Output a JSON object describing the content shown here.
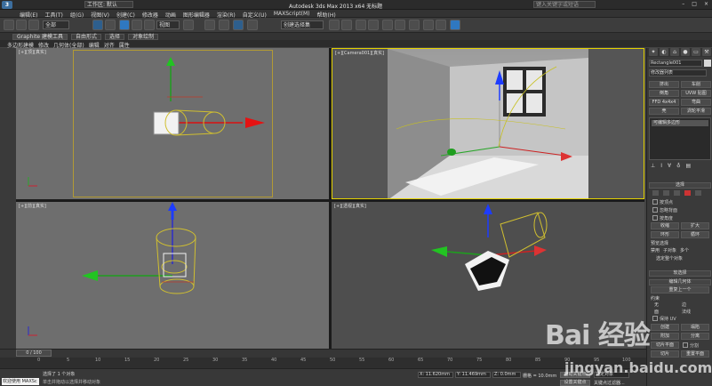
{
  "titlebar": {
    "logo": "3",
    "menu": [
      "编辑(E)",
      "工具(T)",
      "组(G)",
      "视图(V)"
    ],
    "workspace": "工作区: 默认",
    "title": "Autodesk 3ds Max  2013 x64     无标题",
    "search_placeholder": "键入关键字或短语",
    "window_buttons": [
      "–",
      "□",
      "×"
    ]
  },
  "menubar": {
    "items": [
      "编辑(E)",
      "工具(T)",
      "组(G)",
      "视图(V)",
      "创建(C)",
      "修改器",
      "动画",
      "图形编辑器",
      "渲染(R)",
      "自定义(U)",
      "MAXScript(M)",
      "帮助(H)"
    ]
  },
  "toolbar": {
    "filter": "全部",
    "view": "视图",
    "selset": "创建选择集"
  },
  "ribbon": {
    "tabs": [
      "Graphite 建模工具",
      "自由形式",
      "选择",
      "对象绘制"
    ],
    "items": [
      "多边形建模",
      "修改",
      "几何体(全部)",
      "编辑",
      "对齐",
      "属性"
    ]
  },
  "viewports": {
    "top": "[+][顶][真实]",
    "camera": "[+][Camera001][真实]",
    "front": "[+][前][真实]",
    "persp": "[+][透视][真实]"
  },
  "panel": {
    "object_name": "Rectangle001",
    "modifier_list": "修改器列表",
    "buttons": [
      "挤出",
      "车削",
      "倒角",
      "UVW 贴图",
      "FFD 4x4x4",
      "弯曲",
      "壳",
      "涡轮平滑"
    ],
    "stack_item": "可编辑多边形",
    "rollout_select": "选择",
    "options": [
      "按顶点",
      "忽略背面",
      "按角度"
    ],
    "btn_shrink": "收缩",
    "btn_grow": "扩大",
    "btn_ring": "环形",
    "btn_loop": "循环",
    "preview": "预览选择",
    "preview_opts": [
      "禁用",
      "子对象",
      "多个"
    ],
    "selected": "选定整个对象",
    "rollout_soft": "软选择",
    "rollout_geom": "编辑几何体",
    "repeat": "重复上一个",
    "constraint": "约束",
    "constraint_opts": [
      "无",
      "边",
      "面",
      "法线"
    ],
    "keep_uv": "保持 UV",
    "create": "创建",
    "collapse": "塌陷",
    "attach": "附加",
    "detach": "分离",
    "slice_plane": "切片平面",
    "split": "分割",
    "slice": "切片",
    "reset_plane": "重置平面"
  },
  "trackbar": {
    "slider": "0 / 100"
  },
  "ruler": {
    "ticks": [
      "0",
      "5",
      "10",
      "15",
      "20",
      "25",
      "30",
      "35",
      "40",
      "45",
      "50",
      "55",
      "60",
      "65",
      "70",
      "75",
      "80",
      "85",
      "90",
      "95",
      "100"
    ]
  },
  "status": {
    "welcome": "欢迎使用 MAXSc",
    "line1": "选择了 1 个对象",
    "line2": "单击并拖动以选择并移动对象",
    "x": "X: 11.620mm",
    "y": "Y: 11.469mm",
    "z": "Z: 0.0mm",
    "grid": "栅格 = 10.0mm",
    "autokey": "自动关键点",
    "selected": "选定对象",
    "setkey": "设置关键点",
    "keyfilter": "关键点过滤器..."
  },
  "watermark": {
    "brand": "Bai 经验",
    "url": "jingyan.baidu.com"
  }
}
